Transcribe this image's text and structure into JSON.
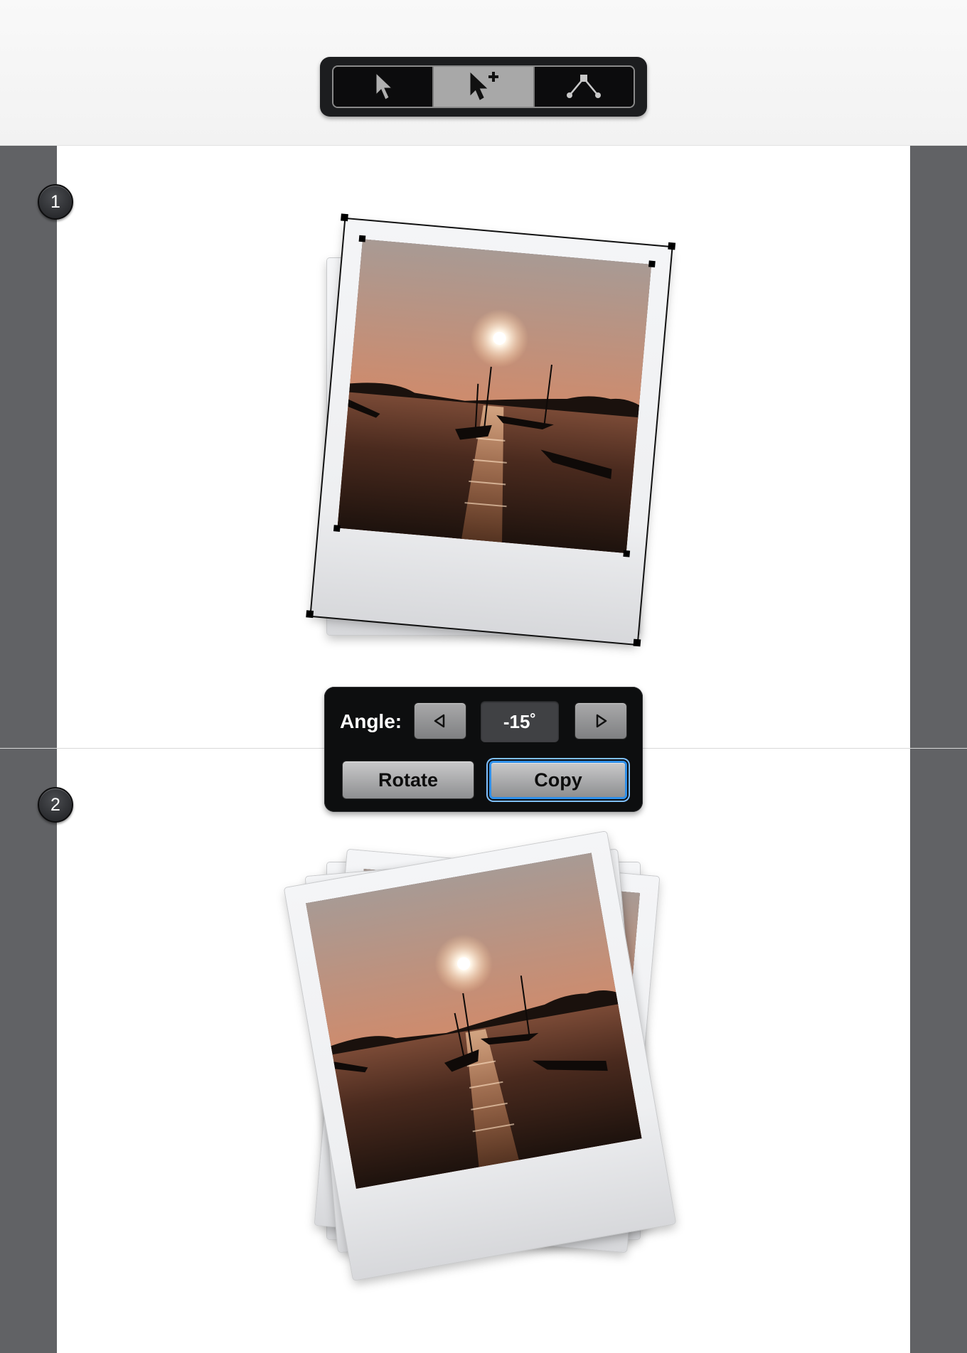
{
  "toolbar": {
    "tools": [
      {
        "name": "selection-tool",
        "icon": "arrow-cursor-icon",
        "active": false
      },
      {
        "name": "group-selection-tool",
        "icon": "arrow-cursor-plus-icon",
        "active": true
      },
      {
        "name": "direct-selection-tool",
        "icon": "anchor-path-icon",
        "active": false
      }
    ]
  },
  "steps": [
    {
      "number": "1"
    },
    {
      "number": "2"
    }
  ],
  "dialog": {
    "angle_label": "Angle:",
    "angle_value": "-15˚",
    "decrease_icon": "triangle-left-icon",
    "increase_icon": "triangle-right-icon",
    "rotate_label": "Rotate",
    "copy_label": "Copy",
    "focused_button": "copy"
  },
  "colors": {
    "gutter": "#616265",
    "panel_background": "#0d0e0f",
    "focus_ring": "#2f8fe8",
    "sky_top": "#b09a8e",
    "sky_horizon": "#d9845a",
    "water": "#2d1a12"
  }
}
